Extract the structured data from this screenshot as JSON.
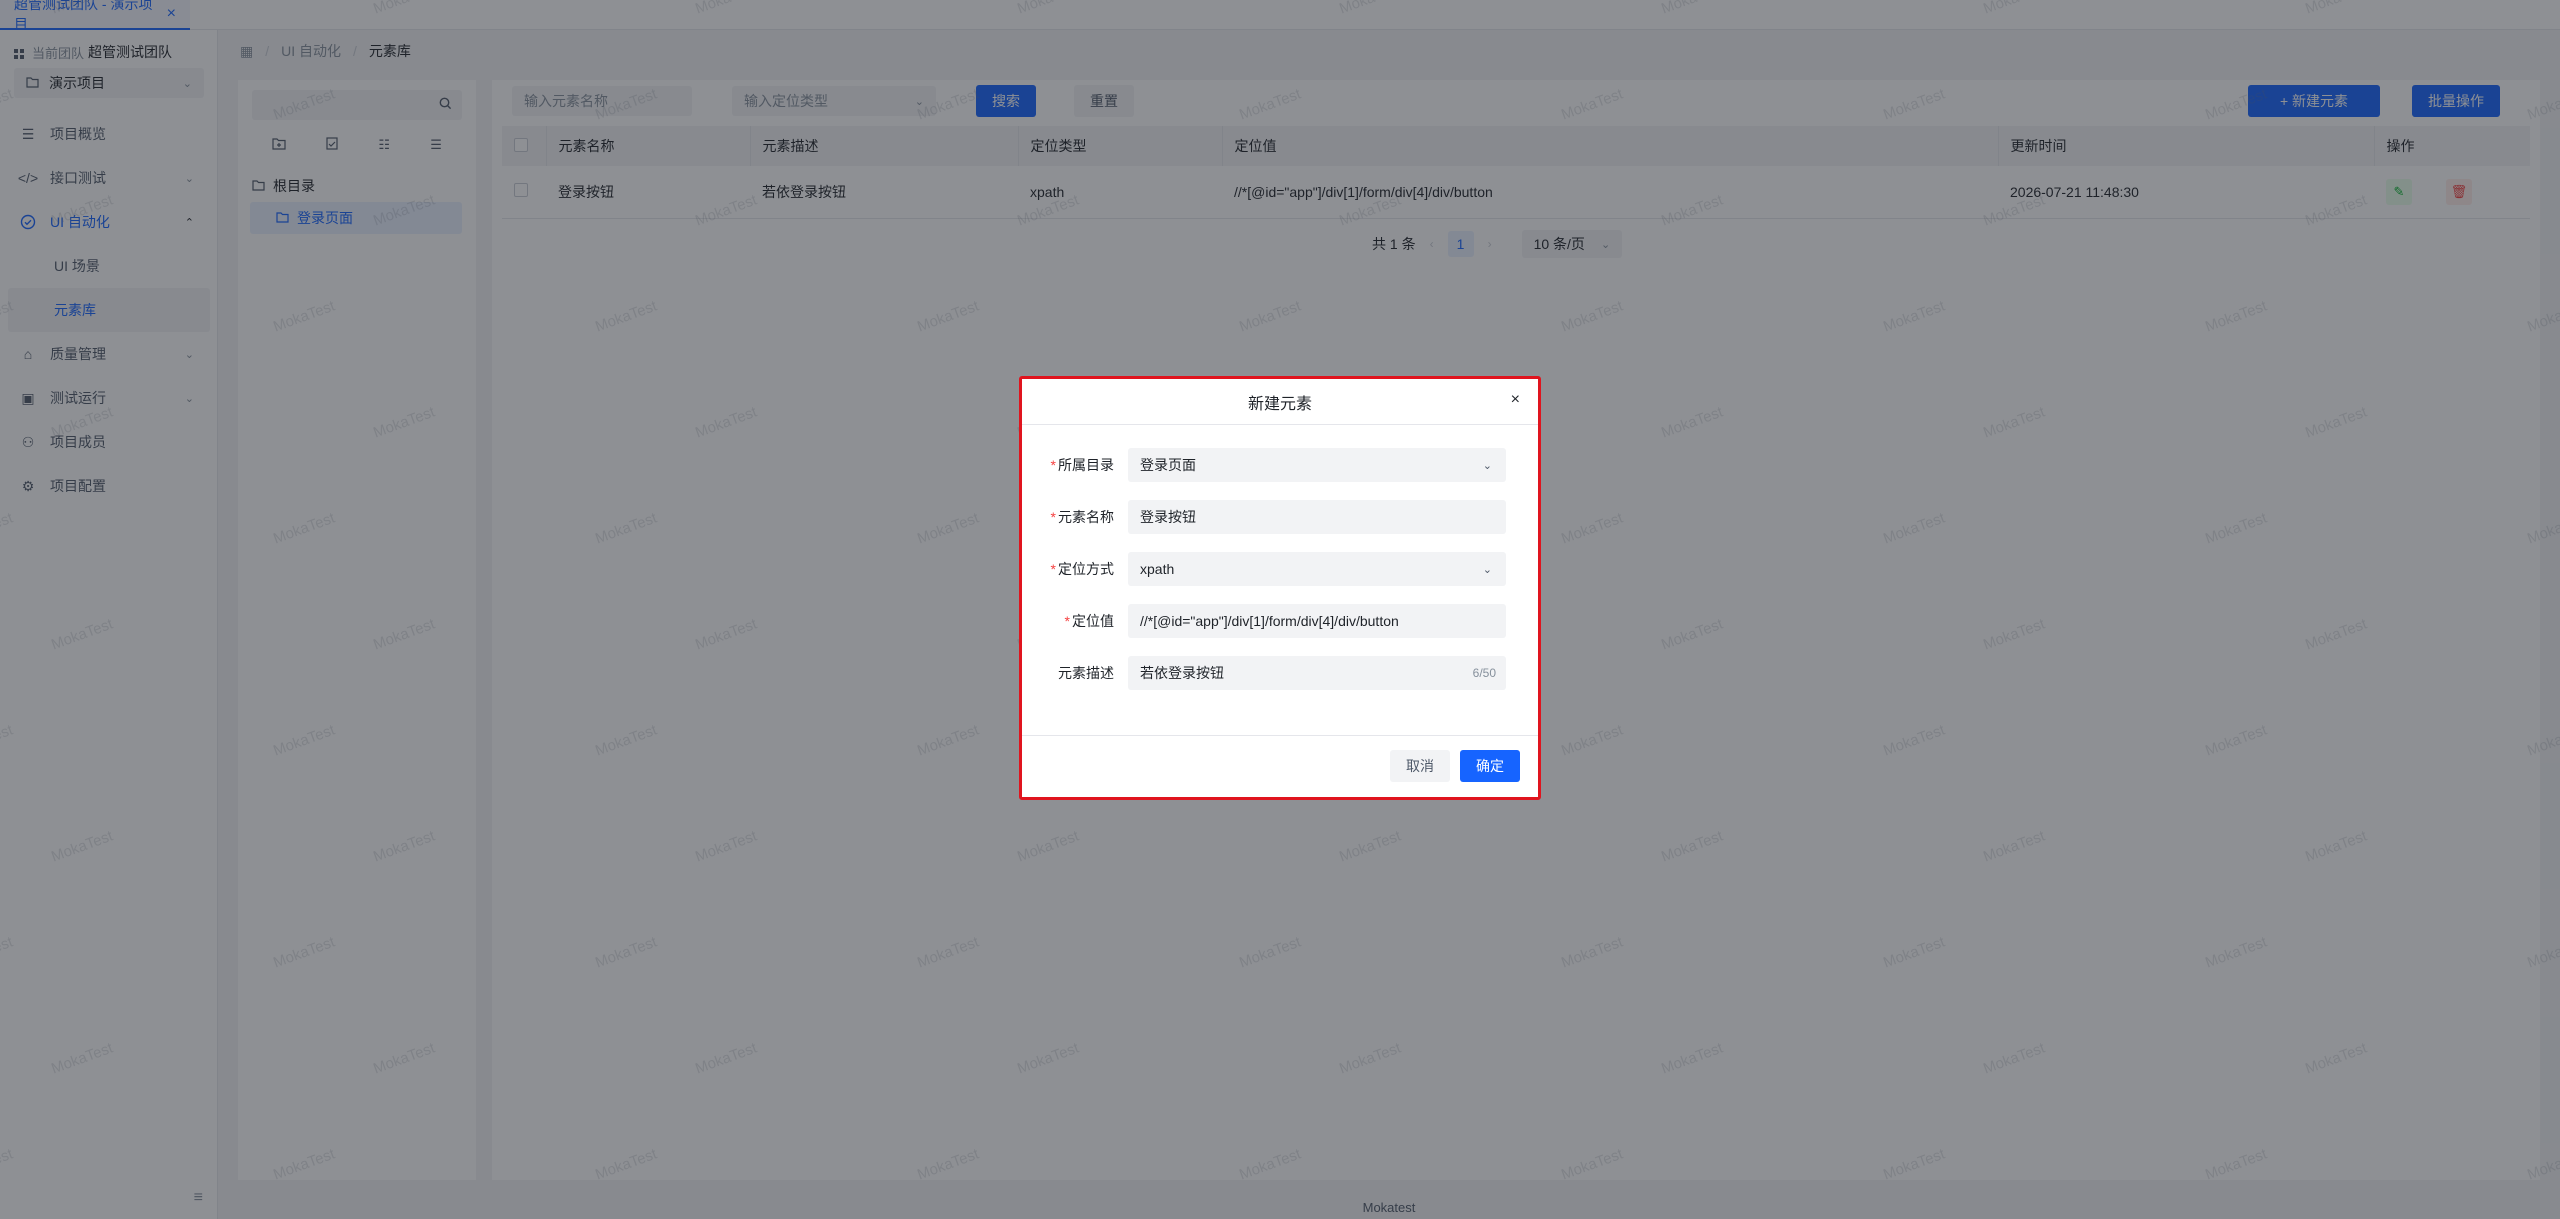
{
  "tab": {
    "label": "超管测试团队 - 演示项目",
    "close": "×"
  },
  "sidebar": {
    "team_prefix": "当前团队",
    "team_name": "超管测试团队",
    "project": "演示项目",
    "items": [
      {
        "label": "项目概览",
        "icon": "list-icon"
      },
      {
        "label": "接口测试",
        "icon": "code-icon"
      },
      {
        "label": "UI 自动化",
        "icon": "check-circle-icon"
      },
      {
        "label": "UI 场景"
      },
      {
        "label": "元素库"
      },
      {
        "label": "质量管理",
        "icon": "bank-icon"
      },
      {
        "label": "测试运行",
        "icon": "calendar-icon"
      },
      {
        "label": "项目成员",
        "icon": "users-icon"
      },
      {
        "label": "项目配置",
        "icon": "gear-icon"
      }
    ],
    "collapse": "≡"
  },
  "breadcrumb": {
    "home": "▦",
    "level1": "UI 自动化",
    "level2": "元素库",
    "sep": "/"
  },
  "tree": {
    "root": "根目录",
    "child": "登录页面"
  },
  "filters": {
    "name_placeholder": "输入元素名称",
    "type_placeholder": "输入定位类型",
    "search": "搜索",
    "reset": "重置",
    "add": "+ 新建元素",
    "batch": "批量操作"
  },
  "table": {
    "headers": [
      "元素名称",
      "元素描述",
      "定位类型",
      "定位值",
      "更新时间",
      "操作"
    ],
    "rows": [
      {
        "name": "登录按钮",
        "desc": "若依登录按钮",
        "type": "xpath",
        "value": "//*[@id=\"app\"]/div[1]/form/div[4]/div/button",
        "time": "2026-07-21 11:48:30"
      }
    ]
  },
  "pager": {
    "total": "共 1 条",
    "page": "1",
    "size": "10 条/页"
  },
  "footer": "Mokatest",
  "watermark": "MokaTest",
  "modal": {
    "title": "新建元素",
    "close": "×",
    "fields": {
      "dir_label": "所属目录",
      "dir_value": "登录页面",
      "name_label": "元素名称",
      "name_value": "登录按钮",
      "method_label": "定位方式",
      "method_value": "xpath",
      "locator_label": "定位值",
      "locator_value": "//*[@id=\"app\"]/div[1]/form/div[4]/div/button",
      "desc_label": "元素描述",
      "desc_value": "若依登录按钮",
      "desc_count": "6/50"
    },
    "cancel": "取消",
    "ok": "确定"
  },
  "colors": {
    "primary": "#1664ff",
    "highlight_border": "#e0141e"
  }
}
